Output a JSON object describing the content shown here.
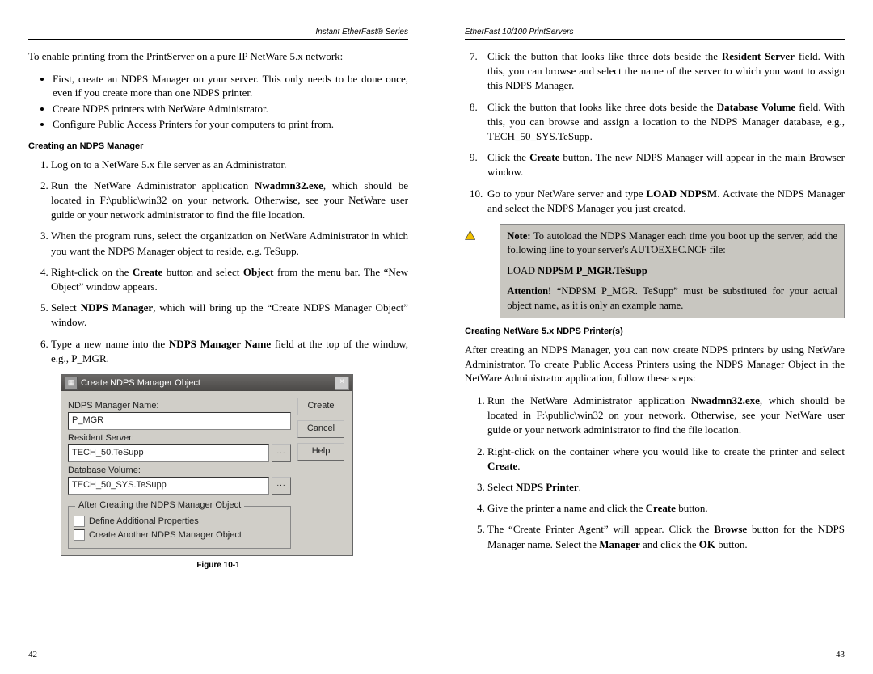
{
  "leftHeader": "Instant EtherFast® Series",
  "rightHeader": "EtherFast 10/100 PrintServers",
  "intro": "To enable printing from the PrintServer on a pure IP NetWare 5.x network:",
  "bullets": [
    "First, create an NDPS Manager on your server.  This only needs to be done once, even if you create more than one NDPS printer.",
    "Create NDPS printers with NetWare Administrator.",
    "Configure Public Access Printers for your computers to print from."
  ],
  "heading1": "Creating an NDPS Manager",
  "steps1": [
    "Log on to a NetWare 5.x file server as an Administrator.",
    "Run the NetWare Administrator application <b>Nwadmn32.exe</b>, which should be located in F:\\public\\win32 on your network. Otherwise, see your NetWare user guide or your network administrator to find the file location.",
    "When the program runs, select the organization on NetWare Administrator in which you want the NDPS Manager object to reside, e.g. TeSupp.",
    "Right-click on the <b>Create</b> button and select <b>Object</b> from the menu bar. The “New Object” window appears.",
    "Select <b>NDPS Manager</b>, which will bring up the “Create NDPS Manager Object” window.",
    "Type a new name into the <b>NDPS Manager Name</b> field at the top of the window, e.g., P_MGR."
  ],
  "dialog": {
    "title": "Create NDPS Manager Object",
    "nameLabel": "NDPS Manager Name:",
    "nameValue": "P_MGR",
    "residentLabel": "Resident Server:",
    "residentValue": "TECH_50.TeSupp",
    "dbLabel": "Database Volume:",
    "dbValue": "TECH_50_SYS.TeSupp",
    "createBtn": "Create",
    "cancelBtn": "Cancel",
    "helpBtn": "Help",
    "groupTitle": "After Creating the NDPS Manager Object",
    "chk1": "Define Additional Properties",
    "chk2": "Create Another NDPS Manager Object",
    "closeGlyph": "×",
    "browseGlyph": "..."
  },
  "figCaption": "Figure 10-1",
  "steps2": [
    "Click the button that looks like three dots beside the <b>Resident Server</b> field. With this, you can browse and select the name of the server to which you want to assign this NDPS Manager.",
    "Click the button that looks like three dots beside the <b>Database Volume</b> field. With this, you can browse and assign a location to the NDPS Manager database, e.g., TECH_50_SYS.TeSupp.",
    "Click the <b>Create</b> button. The new NDPS Manager will appear in the main Browser window.",
    "Go to your NetWare server and type <b>LOAD NDPSM</b>. Activate the NDPS Manager and select the NDPS Manager you just created."
  ],
  "note": {
    "noteLabel": "Note:",
    "noteText": " To autoload the NDPS Manager each time you boot up the server, add the following line to your server's AUTOEXEC.NCF file:",
    "loadPrefix": "LOAD ",
    "loadBold": "NDPSM P_MGR.TeSupp",
    "attnLabel": "Attention!",
    "attnText": " “NDPSM P_MGR. TeSupp” must be substituted for your actual object name, as it is only an example name."
  },
  "heading2": "Creating NetWare 5.x NDPS Printer(s)",
  "afterText": "After creating an NDPS Manager, you can now create NDPS printers by using NetWare Administrator. To create Public Access Printers using the NDPS Manager Object in the NetWare Administrator application, follow these steps:",
  "printerSteps": [
    "Run the NetWare Administrator application <b>Nwadmn32.exe</b>, which should be located in F:\\public\\win32 on your network. Otherwise, see your NetWare user guide or your network administrator to find the file location.",
    "Right-click on the container where you would like to create the printer and select <b>Create</b>.",
    "Select <b>NDPS Printer</b>.",
    "Give the printer a name and click the <b>Create</b> button.",
    "The “Create Printer Agent” will appear.  Click the <b>Browse</b> button for the NDPS Manager name.  Select the <b>Manager</b> and click the <b>OK</b> button."
  ],
  "pageLeft": "42",
  "pageRight": "43"
}
